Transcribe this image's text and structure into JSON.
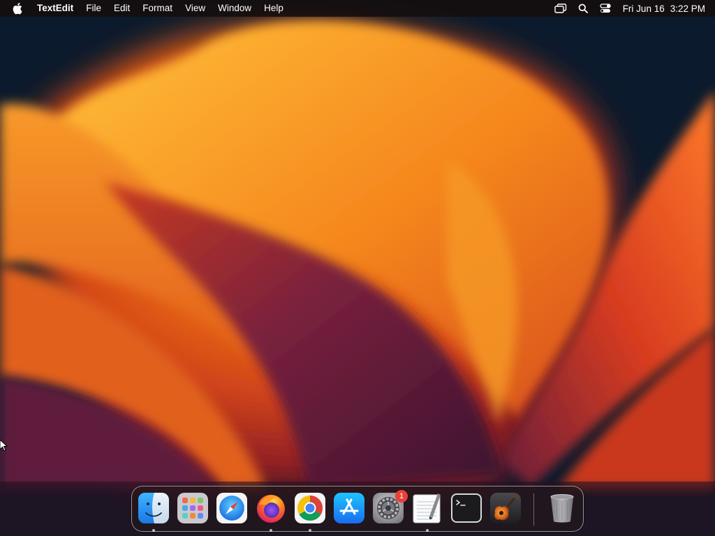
{
  "menubar": {
    "apple_icon": "apple-logo-icon",
    "app_name": "TextEdit",
    "menus": [
      "File",
      "Edit",
      "Format",
      "View",
      "Window",
      "Help"
    ],
    "status_icons": [
      "screen-mirroring-icon",
      "spotlight-search-icon",
      "control-center-icon"
    ],
    "clock": {
      "date": "Fri Jun 16",
      "time": "3:22 PM"
    }
  },
  "dock": {
    "apps": [
      {
        "name": "Finder",
        "icon": "finder-icon",
        "running": true
      },
      {
        "name": "Launchpad",
        "icon": "launchpad-icon",
        "running": false
      },
      {
        "name": "Safari",
        "icon": "safari-icon",
        "running": false
      },
      {
        "name": "Firefox",
        "icon": "firefox-icon",
        "running": true
      },
      {
        "name": "Google Chrome",
        "icon": "chrome-icon",
        "running": true
      },
      {
        "name": "App Store",
        "icon": "app-store-icon",
        "running": false
      },
      {
        "name": "System Preferences",
        "icon": "system-preferences-icon",
        "running": false,
        "badge": "1"
      },
      {
        "name": "TextEdit",
        "icon": "textedit-icon",
        "running": true
      },
      {
        "name": "Terminal",
        "icon": "terminal-icon",
        "running": false
      },
      {
        "name": "GarageBand",
        "icon": "garageband-icon",
        "running": false
      }
    ],
    "trash": {
      "name": "Trash",
      "icon": "trash-icon"
    }
  },
  "colors": {
    "wallpaper_dark": "#0b1a2c",
    "wallpaper_orange": "#f2761a",
    "wallpaper_magenta": "#6a1f3a",
    "badge_red": "#e8413a"
  }
}
